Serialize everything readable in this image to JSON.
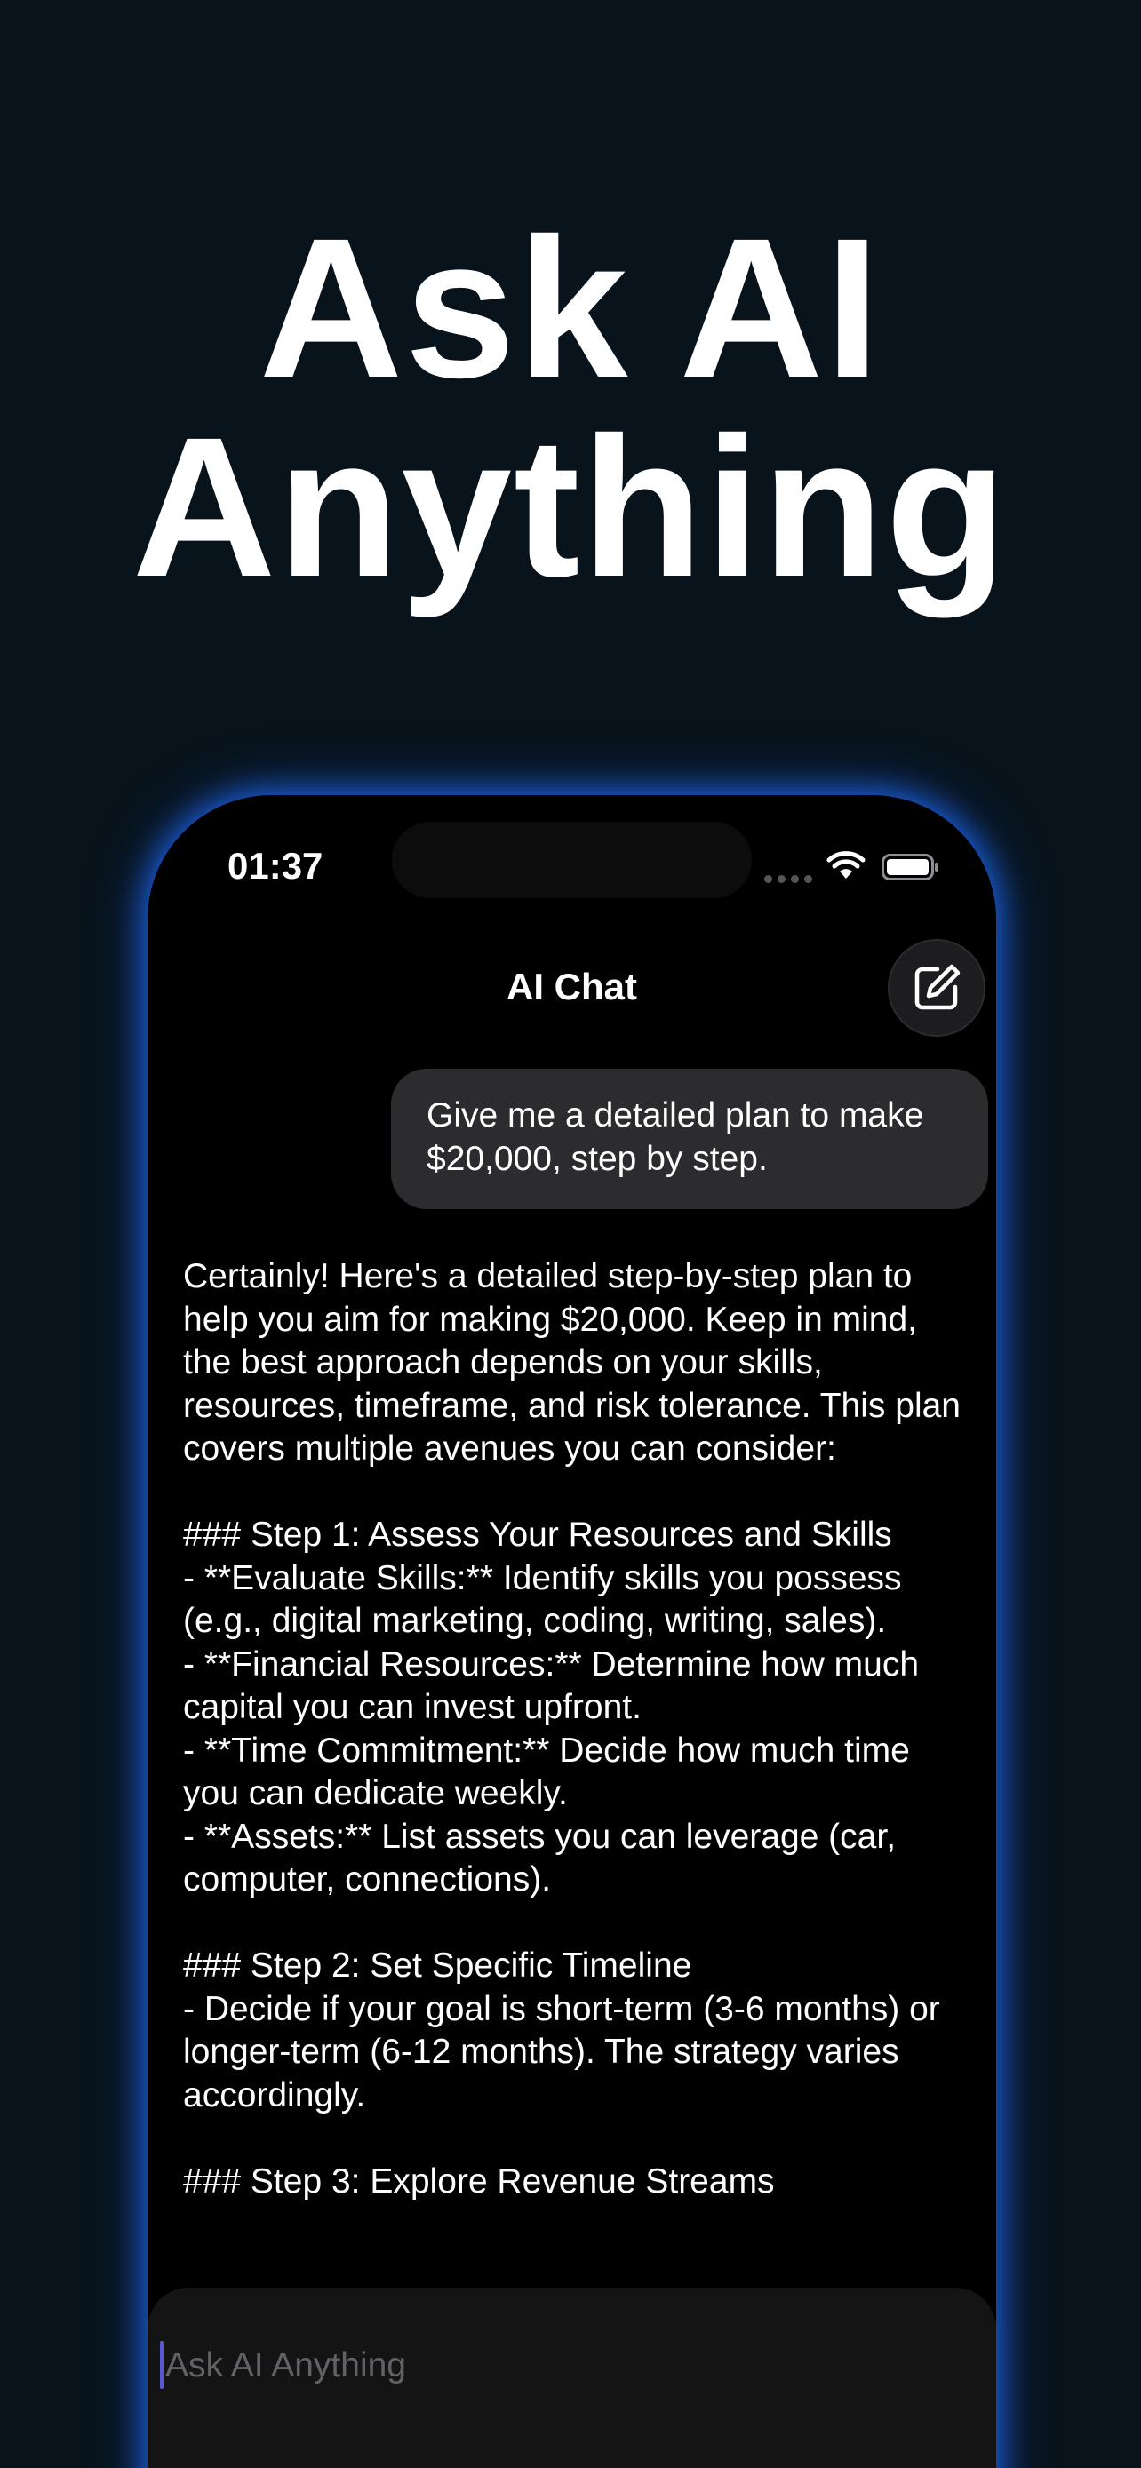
{
  "headline": {
    "line1": "Ask AI",
    "line2": "Anything"
  },
  "status_bar": {
    "time": "01:37"
  },
  "nav": {
    "title": "AI Chat"
  },
  "conversation": {
    "user_message": "Give me a detailed plan to make $20,000, step by step.",
    "ai_response": "Certainly! Here's a detailed step-by-step plan to help you aim for making $20,000. Keep in mind, the best approach depends on your skills, resources, timeframe, and risk tolerance. This plan covers multiple avenues you can consider:\n\n### Step 1: Assess Your Resources and Skills\n- **Evaluate Skills:** Identify skills you possess (e.g., digital marketing, coding, writing, sales).\n- **Financial Resources:** Determine how much capital you can invest upfront.\n- **Time Commitment:** Decide how much time you can dedicate weekly.\n- **Assets:** List assets you can leverage (car, computer, connections).\n\n### Step 2: Set Specific Timeline\n- Decide if your goal is short-term (3-6 months) or longer-term (6-12 months). The strategy varies accordingly.\n\n### Step 3: Explore Revenue Streams"
  },
  "composer": {
    "placeholder": "Ask AI Anything"
  },
  "colors": {
    "background": "#08131b",
    "phone_glow": "#1f6eff",
    "user_bubble": "#2c2c2e",
    "cursor": "#5b57d9"
  },
  "icons": {
    "compose": "compose-icon",
    "wifi": "wifi-icon",
    "battery": "battery-icon"
  }
}
